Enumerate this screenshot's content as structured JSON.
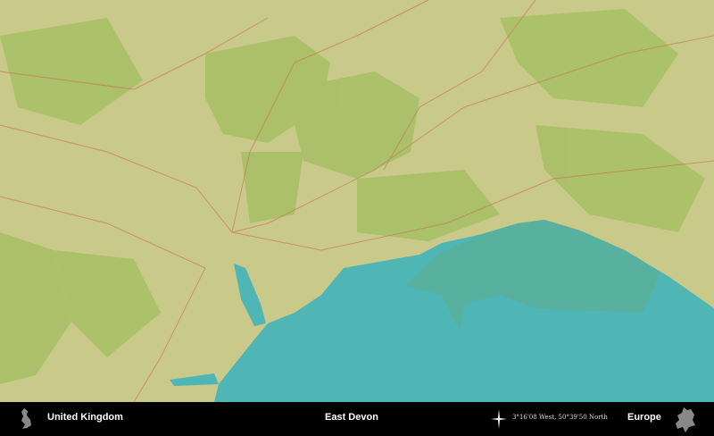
{
  "footer": {
    "country": "United Kingdom",
    "region": "East Devon",
    "coordinates": "3°16'08 West, 50°39'50 North",
    "continent": "Europe"
  },
  "icons": {
    "country_silhouette": "uk-silhouette-icon",
    "compass": "compass-star-icon",
    "continent_silhouette": "europe-silhouette-icon"
  },
  "colors": {
    "land": "#c9c98a",
    "land_green": "#9fbf5e",
    "sea": "#4fb5b5",
    "shelf": "#5aaf9a",
    "roads": "#c77a5a"
  }
}
